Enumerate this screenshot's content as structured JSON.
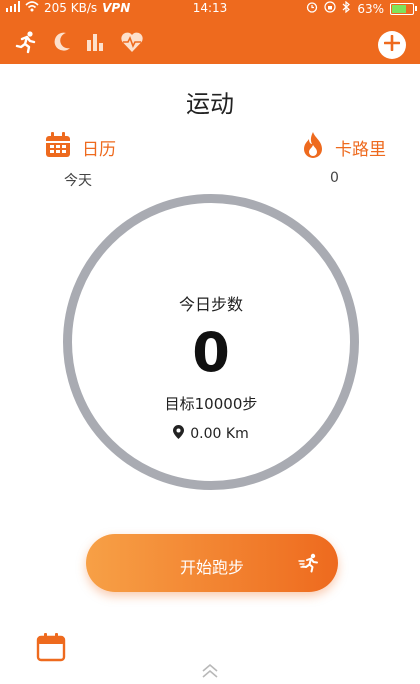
{
  "status_bar": {
    "network_speed": "205 KB/s",
    "vpn": "VPN",
    "time": "14:13",
    "battery": "63%"
  },
  "top_nav": {
    "icons": [
      "run-icon",
      "moon-icon",
      "bar-chart-icon",
      "heart-rate-icon"
    ],
    "add_icon": "plus-circle-icon"
  },
  "page": {
    "title": "运动"
  },
  "stats": {
    "calendar": {
      "label": "日历",
      "value": "今天",
      "icon": "calendar-icon"
    },
    "calories": {
      "label": "卡路里",
      "value": "0",
      "icon": "flame-icon"
    }
  },
  "ring": {
    "title": "今日步数",
    "steps": "0",
    "goal": "目标10000步",
    "distance": "0.00 Km"
  },
  "run_button": {
    "label": "开始跑步"
  },
  "colors": {
    "accent": "#ee6a1e",
    "ring": "#a9abb2"
  }
}
